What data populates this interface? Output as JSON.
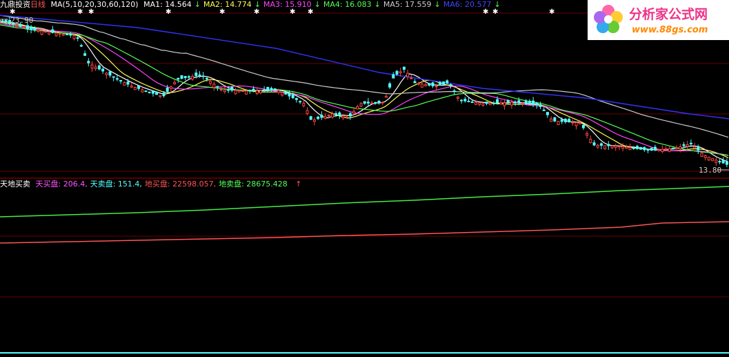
{
  "main_panel": {
    "name": "九鼎投资",
    "period": "日线",
    "ma_params": "MA(5,10,20,30,60,120)",
    "ma_values": [
      {
        "label": "MA1:",
        "value": "14.564",
        "arrow": "↓",
        "color": "#ffffff"
      },
      {
        "label": "MA2:",
        "value": "14.774",
        "arrow": "↓",
        "color": "#ffff55"
      },
      {
        "label": "MA3:",
        "value": "15.910",
        "arrow": "↓",
        "color": "#ff44ff"
      },
      {
        "label": "MA4:",
        "value": "16.083",
        "arrow": "↓",
        "color": "#55ff55"
      },
      {
        "label": "MA5:",
        "value": "17.559",
        "arrow": "↓",
        "color": "#cccccc"
      },
      {
        "label": "MA6:",
        "value": "20.577",
        "arrow": "↓",
        "color": "#4444ff"
      }
    ],
    "high_label": "23.90",
    "low_label": "13.80"
  },
  "sub_panel": {
    "title": "天地买卖",
    "items": [
      {
        "label": "天买盘:",
        "value": "206.4,",
        "color": "#ff55ff"
      },
      {
        "label": "天卖盘:",
        "value": "151.4,",
        "color": "#55ffff"
      },
      {
        "label": "地买盘:",
        "value": "22598.057,",
        "color": "#ff5555"
      },
      {
        "label": "地卖盘:",
        "value": "28675.428",
        "color": "#55ff55"
      }
    ],
    "trend_arrow": "↑"
  },
  "logo": {
    "title": "分析家公式网",
    "url": "www.88gs.com"
  },
  "colors": {
    "up": "#ff4444",
    "down": "#55ffff",
    "grid": "#7a0000",
    "green_line": "#44ee44",
    "red_line": "#ff5555"
  }
}
